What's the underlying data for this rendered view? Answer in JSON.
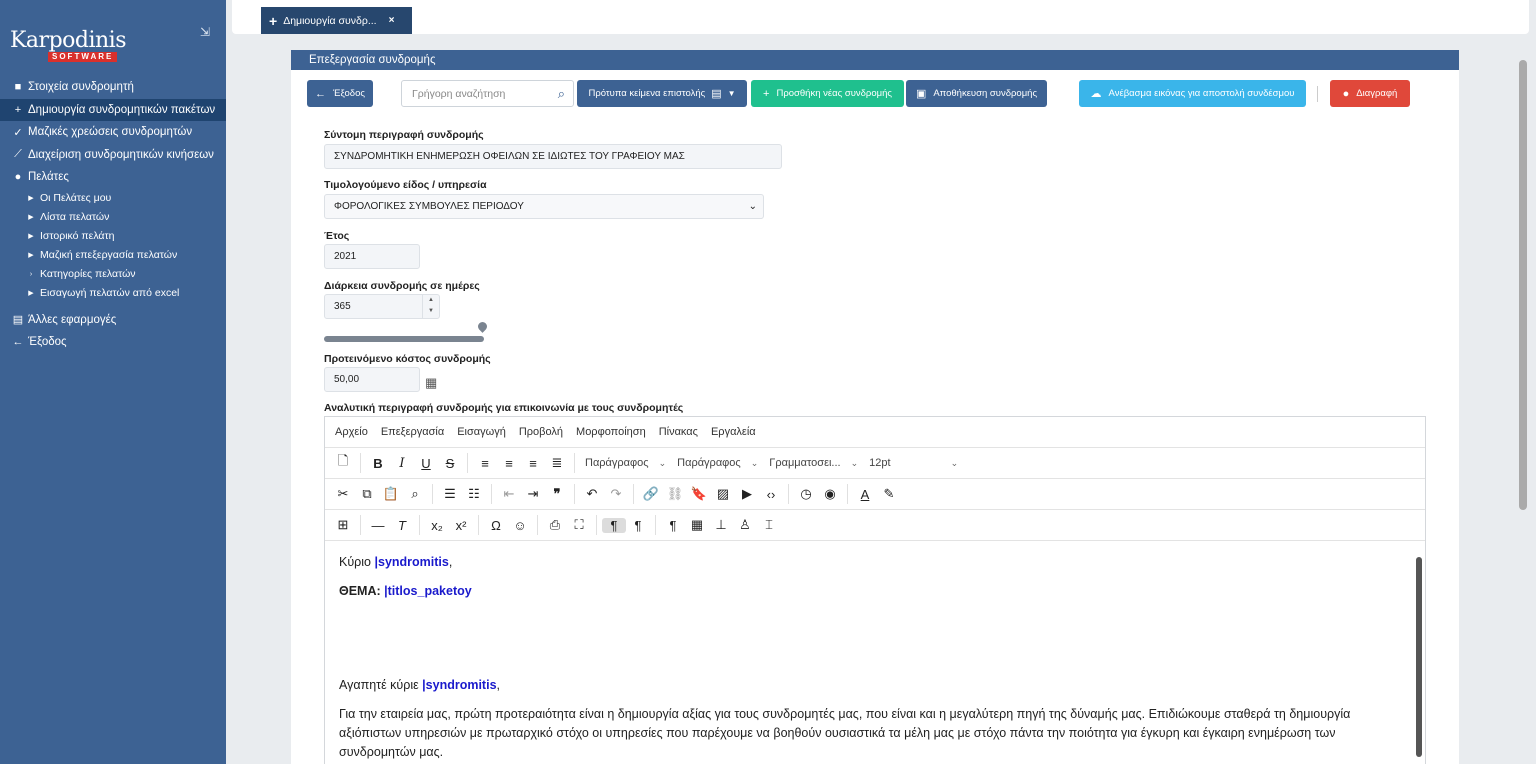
{
  "sidebar": {
    "logo_text": "Karpodinis",
    "logo_sub": "SOFTWARE",
    "collapse_icon": "••",
    "items": [
      {
        "label": "Στοιχεία συνδρομητή",
        "icon": "user-icon"
      },
      {
        "label": "Δημιουργία συνδρομητικών πακέτων",
        "icon": "plus-icon"
      },
      {
        "label": "Μαζικές χρεώσεις συνδρομητών",
        "icon": "check-double-icon"
      },
      {
        "label": "Διαχείριση συνδρομητικών κινήσεων",
        "icon": "chart-line-icon"
      },
      {
        "label": "Πελάτες",
        "icon": "users-icon"
      },
      {
        "label": "Οι Πελάτες μου",
        "icon": "caret-right-icon"
      },
      {
        "label": "Λίστα πελατών",
        "icon": "caret-right-icon"
      },
      {
        "label": "Ιστορικό πελάτη",
        "icon": "caret-right-icon"
      },
      {
        "label": "Μαζική επεξεργασία πελατών",
        "icon": "caret-right-icon"
      },
      {
        "label": "Κατηγορίες πελατών",
        "icon": "caret-right-icon"
      },
      {
        "label": "Εισαγωγή πελατών από excel",
        "icon": "caret-right-icon"
      },
      {
        "label": "Άλλες εφαρμογές",
        "icon": "apps-icon"
      },
      {
        "label": "Έξοδος",
        "icon": "arrow-left-icon"
      }
    ]
  },
  "tabs": [
    {
      "label": "Δημιουργία συνδρ...",
      "close": "×"
    }
  ],
  "panel": {
    "title": "Επεξεργασία συνδρομής",
    "toolbar": {
      "exit": "Έξοδος",
      "search_placeholder": "Γρήγορη αναζήτηση",
      "templates": "Πρότυπα κείμενα επιστολής",
      "add": "Προσθήκη νέας συνδρομής",
      "save": "Αποθήκευση συνδρομής",
      "upload": "Ανέβασμα εικόνας για αποστολή συνδέσμου",
      "delete": "Διαγραφή"
    },
    "form": {
      "short_desc_label": "Σύντομη περιγραφή συνδρομής",
      "short_desc_value": "ΣΥΝΔΡΟΜΗΤΙΚΗ ΕΝΗΜΕΡΩΣΗ ΟΦΕΙΛΩΝ ΣΕ ΙΔΙΩΤΕΣ ΤΟΥ ΓΡΑΦΕΙΟΥ ΜΑΣ",
      "item_label": "Τιμολογούμενο είδος / υπηρεσία",
      "item_value": "ΦΟΡΟΛΟΓΙΚΕΣ ΣΥΜΒΟΥΛΕΣ ΠΕΡΙΟΔΟΥ",
      "year_label": "Έτος",
      "year_value": "2021",
      "duration_label": "Διάρκεια συνδρομής σε ημέρες",
      "duration_value": "365",
      "cost_label": "Προτεινόμενο κόστος συνδρομής",
      "cost_value": "50,00",
      "desc_label": "Αναλυτική περιγραφή συνδρομής για επικοινωνία με τους συνδρομητές"
    },
    "editor": {
      "menu": [
        "Αρχείο",
        "Επεξεργασία",
        "Εισαγωγή",
        "Προβολή",
        "Μορφοποίηση",
        "Πίνακας",
        "Εργαλεία"
      ],
      "block_format": "Παράγραφος",
      "block_format2": "Παράγραφος",
      "font_family": "Γραμματοσει...",
      "font_size": "12pt",
      "line1_pre": "Κύριο ",
      "line1_field": "|syndromitis",
      "line1_post": ",",
      "line2_pre": "ΘΕΜΑ: ",
      "line2_field": "|titlos_paketoy",
      "line3_pre": "Αγαπητέ κύριε ",
      "line3_field": "|syndromitis",
      "line3_post": ",",
      "body": "Για την εταιρεία μας, πρώτη προτεραιότητα είναι η δημιουργία αξίας για τους συνδρομητές μας, που είναι και η μεγαλύτερη πηγή της δύναμής μας. Επιδιώκουμε σταθερά τη δημιουργία αξιόπιστων υπηρεσιών με πρωταρχικό στόχο οι υπηρεσίες που παρέχουμε να βοηθούν ουσιαστικά τα μέλη μας με στόχο πάντα την ποιότητα για έγκυρη και έγκαιρη ενημέρωση των συνδρομητών μας."
    }
  }
}
